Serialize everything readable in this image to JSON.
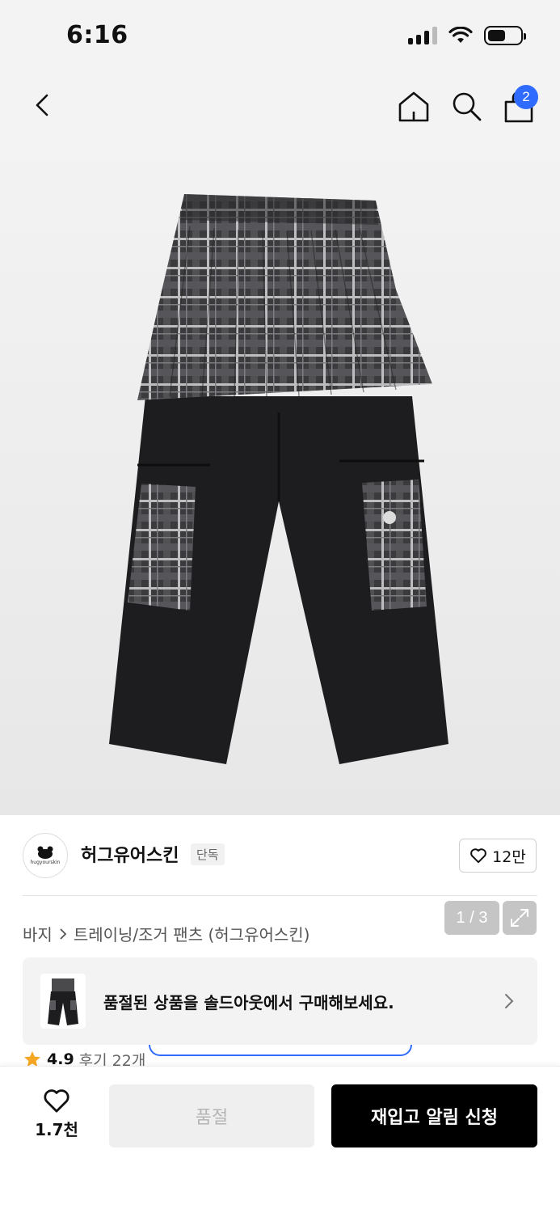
{
  "status_bar": {
    "time": "6:16"
  },
  "nav": {
    "cart_count": "2"
  },
  "gallery": {
    "current": "1 / 3"
  },
  "brand": {
    "name": "허그유어스킨",
    "tag": "단독",
    "logo_text": "hugyourskin",
    "likes": "12만"
  },
  "breadcrumb": {
    "category": "바지",
    "subcategory": "트레이닝/조거 팬츠 (허그유어스킨)"
  },
  "soldout_banner": {
    "text": "품절된 상품을 솔드아웃에서 구매해보세요."
  },
  "rating": {
    "score": "4.9",
    "reviews": "후기 22개"
  },
  "bottom_bar": {
    "like_count": "1.7천",
    "soldout_label": "품절",
    "restock_label": "재입고 알림 신청"
  },
  "colors": {
    "accent": "#2f6bff",
    "rating_star": "#f5a623",
    "primary_button": "#000000"
  }
}
